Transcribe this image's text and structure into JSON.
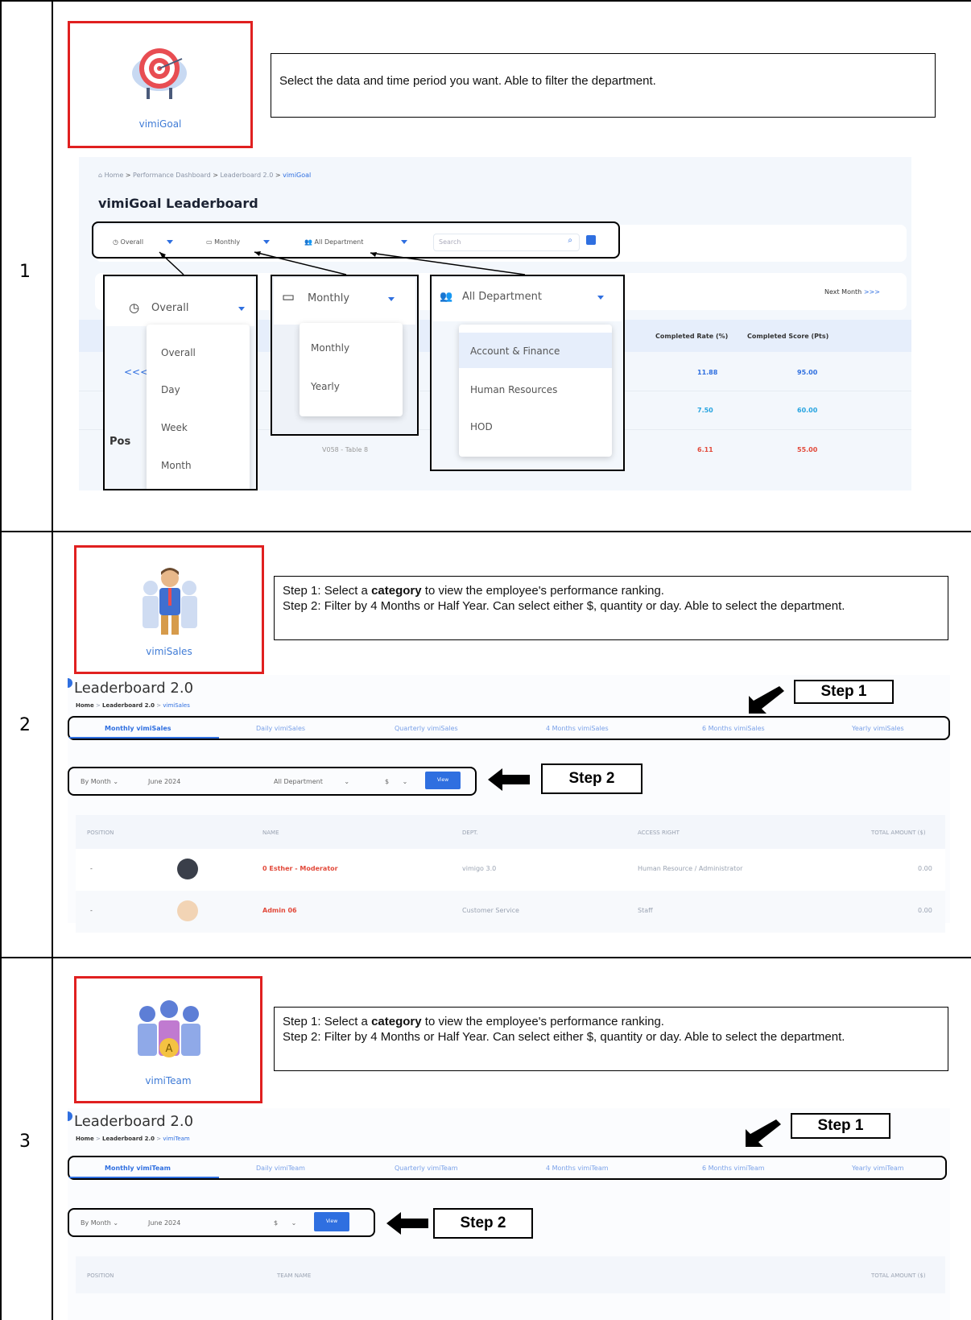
{
  "rows": [
    {
      "num": "1",
      "icon_label": "vimiGoal",
      "description": "Select the data and time period you want. Able to filter the department.",
      "breadcrumb": {
        "home": "Home",
        "perf": "Performance Dashboard",
        "lb": "Leaderboard 2.0",
        "current": "vimiGoal"
      },
      "title": "vimiGoal Leaderboard",
      "filters": {
        "overall": "Overall",
        "monthly": "Monthly",
        "dept": "All Department",
        "search_placeholder": "Search"
      },
      "next_month": "Next Month",
      "next_month_arrows": ">>>",
      "prev_arrows": "<<<",
      "headers": {
        "rate": "Completed Rate (%)",
        "score": "Completed Score (Pts)"
      },
      "rates": [
        "11.88",
        "7.50",
        "6.11"
      ],
      "scores": [
        "95.00",
        "60.00",
        "55.00"
      ],
      "hidden_text": {
        "pos": "Pos",
        "mid": "V058 - Table 8"
      },
      "popup_overall": {
        "selected": "Overall",
        "items": [
          "Overall",
          "Day",
          "Week",
          "Month"
        ]
      },
      "popup_monthly": {
        "selected": "Monthly",
        "items": [
          "Monthly",
          "Yearly"
        ]
      },
      "popup_dept": {
        "selected": "All Department",
        "items": [
          "Account & Finance",
          "Human Resources",
          "HOD"
        ]
      }
    },
    {
      "num": "2",
      "icon_label": "vimiSales",
      "description_lines": [
        {
          "pre": "Step 1: Select a ",
          "bold": "category",
          "post": " to view the employee's performance ranking."
        },
        {
          "pre": "Step 2: Filter by 4 Months or Half Year. Can select either $, quantity or day. Able to select the department.",
          "bold": "",
          "post": ""
        }
      ],
      "lb_title": "Leaderboard 2.0",
      "breadcrumb": {
        "home": "Home",
        "lb": "Leaderboard 2.0",
        "current": "vimiSales"
      },
      "tabs": [
        "Monthly vimiSales",
        "Daily vimiSales",
        "Quarterly vimiSales",
        "4 Months vimiSales",
        "6 Months vimiSales",
        "Yearly vimiSales"
      ],
      "filters": {
        "by": "By Month",
        "date": "June 2024",
        "dept": "All Department",
        "unit": "$",
        "view": "View"
      },
      "step1": "Step 1",
      "step2": "Step 2",
      "table_headers": [
        "POSITION",
        "NAME",
        "DEPT.",
        "ACCESS RIGHT",
        "TOTAL AMOUNT ($)"
      ],
      "table_rows": [
        {
          "pos": "-",
          "name": "0 Esther - Moderator",
          "dept": "vimigo 3.0",
          "access": "Human Resource / Administrator",
          "amount": "0.00"
        },
        {
          "pos": "-",
          "name": "Admin 06",
          "dept": "Customer Service",
          "access": "Staff",
          "amount": "0.00"
        }
      ]
    },
    {
      "num": "3",
      "icon_label": "vimiTeam",
      "description_lines": [
        {
          "pre": "Step 1: Select a ",
          "bold": "category",
          "post": " to view the employee's performance ranking."
        },
        {
          "pre": "Step 2: Filter by 4 Months or Half Year. Can select either $, quantity or day. Able to select the department.",
          "bold": "",
          "post": ""
        }
      ],
      "lb_title": "Leaderboard 2.0",
      "breadcrumb": {
        "home": "Home",
        "lb": "Leaderboard 2.0",
        "current": "vimiTeam"
      },
      "tabs": [
        "Monthly vimiTeam",
        "Daily vimiTeam",
        "Quarterly vimiTeam",
        "4 Months vimiTeam",
        "6 Months vimiTeam",
        "Yearly vimiTeam"
      ],
      "filters": {
        "by": "By Month",
        "date": "June 2024",
        "unit": "$",
        "view": "View"
      },
      "step1": "Step 1",
      "step2": "Step 2",
      "table_headers": [
        "POSITION",
        "TEAM NAME",
        "TOTAL AMOUNT ($)"
      ]
    }
  ]
}
